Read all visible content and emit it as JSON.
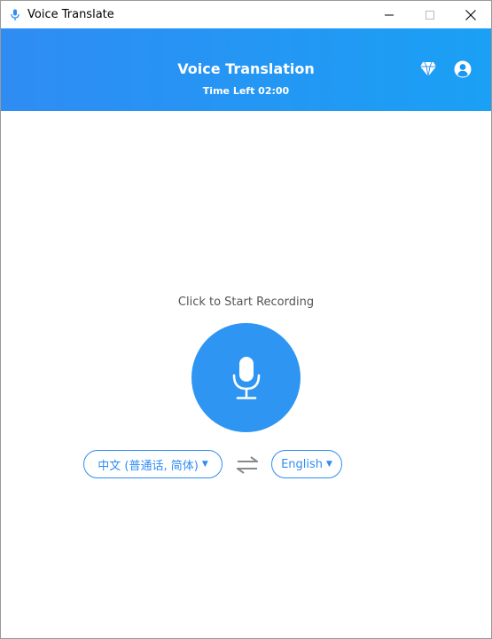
{
  "window": {
    "title": "Voice Translate",
    "controls": [
      "minimize-icon",
      "maximize-icon",
      "close-icon"
    ]
  },
  "header": {
    "title": "Voice Translation",
    "time_left": "Time Left 02:00",
    "icons": [
      "diamond-icon",
      "account-icon"
    ],
    "gradient_colors": [
      "#2f8cf3",
      "#1aa0f5"
    ]
  },
  "main": {
    "prompt": "Click to Start Recording",
    "mic_icon": "microphone-icon",
    "mic_color": "#2f95f3",
    "source_language": "中文 (普通话, 简体)",
    "target_language": "English",
    "swap_icon": "swap-arrows-icon",
    "accent_color": "#2f8cf3"
  }
}
